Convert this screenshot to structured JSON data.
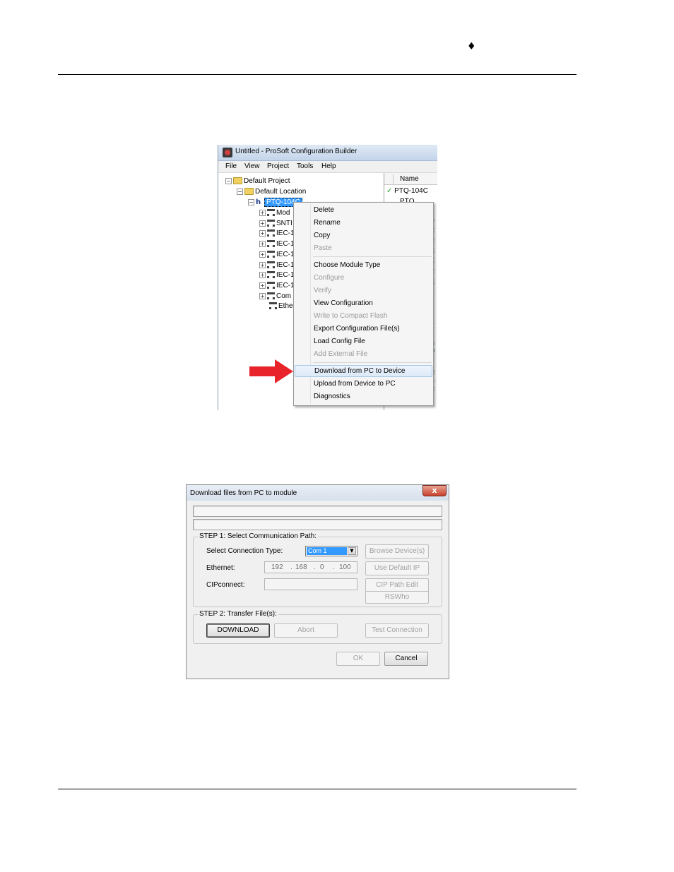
{
  "page": {
    "header_symbol": "♦"
  },
  "shot1": {
    "window_title": "Untitled - ProSoft Configuration Builder",
    "menu": [
      "File",
      "View",
      "Project",
      "Tools",
      "Help"
    ],
    "tree": {
      "project": "Default Project",
      "location": "Default Location",
      "module": "PTQ-104C",
      "children": [
        "Mod",
        "SNTI",
        "IEC-1",
        "IEC-1",
        "IEC-1",
        "IEC-1",
        "IEC-1",
        "IEC-1",
        "Com",
        "Ethe"
      ]
    },
    "list_header": "Name",
    "list_rows": [
      "PTQ-104C",
      "PTQ"
    ],
    "context_menu": [
      {
        "label": "Delete",
        "enabled": true
      },
      {
        "label": "Rename",
        "enabled": true
      },
      {
        "label": "Copy",
        "enabled": true
      },
      {
        "label": "Paste",
        "enabled": false
      },
      {
        "label": "Choose Module Type",
        "enabled": true
      },
      {
        "label": "Configure",
        "enabled": false
      },
      {
        "label": "Verify",
        "enabled": false
      },
      {
        "label": "View Configuration",
        "enabled": true
      },
      {
        "label": "Write to Compact Flash",
        "enabled": false
      },
      {
        "label": "Export Configuration File(s)",
        "enabled": true
      },
      {
        "label": "Load Config File",
        "enabled": true
      },
      {
        "label": "Add External File",
        "enabled": false
      },
      {
        "label": "Download from PC to Device",
        "enabled": true,
        "highlighted": true
      },
      {
        "label": "Upload from Device to PC",
        "enabled": true
      },
      {
        "label": "Diagnostics",
        "enabled": true
      }
    ],
    "arrow_color": "#e8242a"
  },
  "shot2": {
    "title": "Download files from PC to module",
    "close_glyph": "x",
    "step1_legend": "STEP 1: Select Communication Path:",
    "connection_type_label": "Select Connection Type:",
    "connection_type_value": "Com 1",
    "ethernet_label": "Ethernet:",
    "ip_octets": [
      "192",
      "168",
      "0",
      "100"
    ],
    "cipconnect_label": "CIPconnect:",
    "browse_button": "Browse Device(s)",
    "default_ip_button": "Use Default IP",
    "cip_path_button": "CIP Path Edit",
    "rswho_button": "RSWho",
    "step2_legend": "STEP 2: Transfer File(s):",
    "download_button": "DOWNLOAD",
    "abort_button": "Abort",
    "test_button": "Test Connection",
    "ok_button": "OK",
    "cancel_button": "Cancel"
  }
}
